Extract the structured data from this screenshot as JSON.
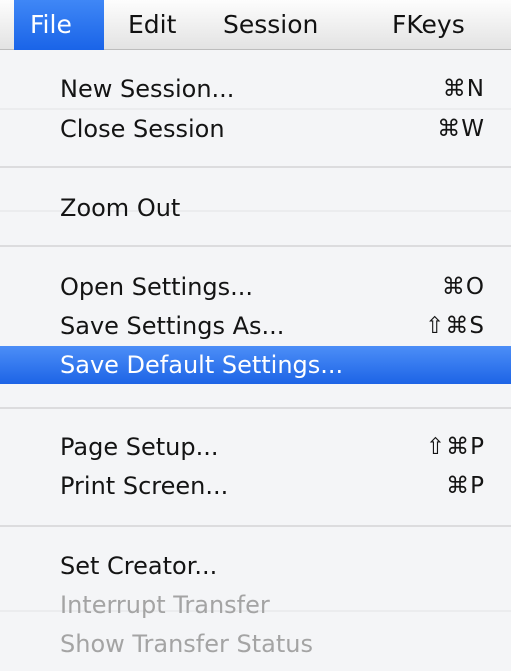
{
  "menubar": {
    "items": [
      {
        "label": "File"
      },
      {
        "label": "Edit"
      },
      {
        "label": "Session"
      },
      {
        "label": "FKeys"
      }
    ],
    "active_item": "File"
  },
  "file_menu": {
    "items": [
      {
        "label": "New Session...",
        "shortcut": "⌘N",
        "enabled": true
      },
      {
        "label": "Close Session",
        "shortcut": "⌘W",
        "enabled": true
      },
      {
        "label": "Zoom Out",
        "shortcut": "",
        "enabled": true
      },
      {
        "label": "Open Settings...",
        "shortcut": "⌘O",
        "enabled": true
      },
      {
        "label": "Save Settings As...",
        "shortcut": "⇧⌘S",
        "enabled": true
      },
      {
        "label": "Save Default Settings...",
        "shortcut": "",
        "enabled": true,
        "highlighted": true
      },
      {
        "label": "Page Setup...",
        "shortcut": "⇧⌘P",
        "enabled": true
      },
      {
        "label": "Print Screen...",
        "shortcut": "⌘P",
        "enabled": true
      },
      {
        "label": "Set Creator...",
        "shortcut": "",
        "enabled": true
      },
      {
        "label": "Interrupt Transfer",
        "shortcut": "",
        "enabled": false
      },
      {
        "label": "Show Transfer Status",
        "shortcut": "",
        "enabled": false
      }
    ]
  },
  "colors": {
    "highlight": "#2a6ff0",
    "disabled_text": "#a4a4a4",
    "menu_background": "#f4f5f7"
  }
}
